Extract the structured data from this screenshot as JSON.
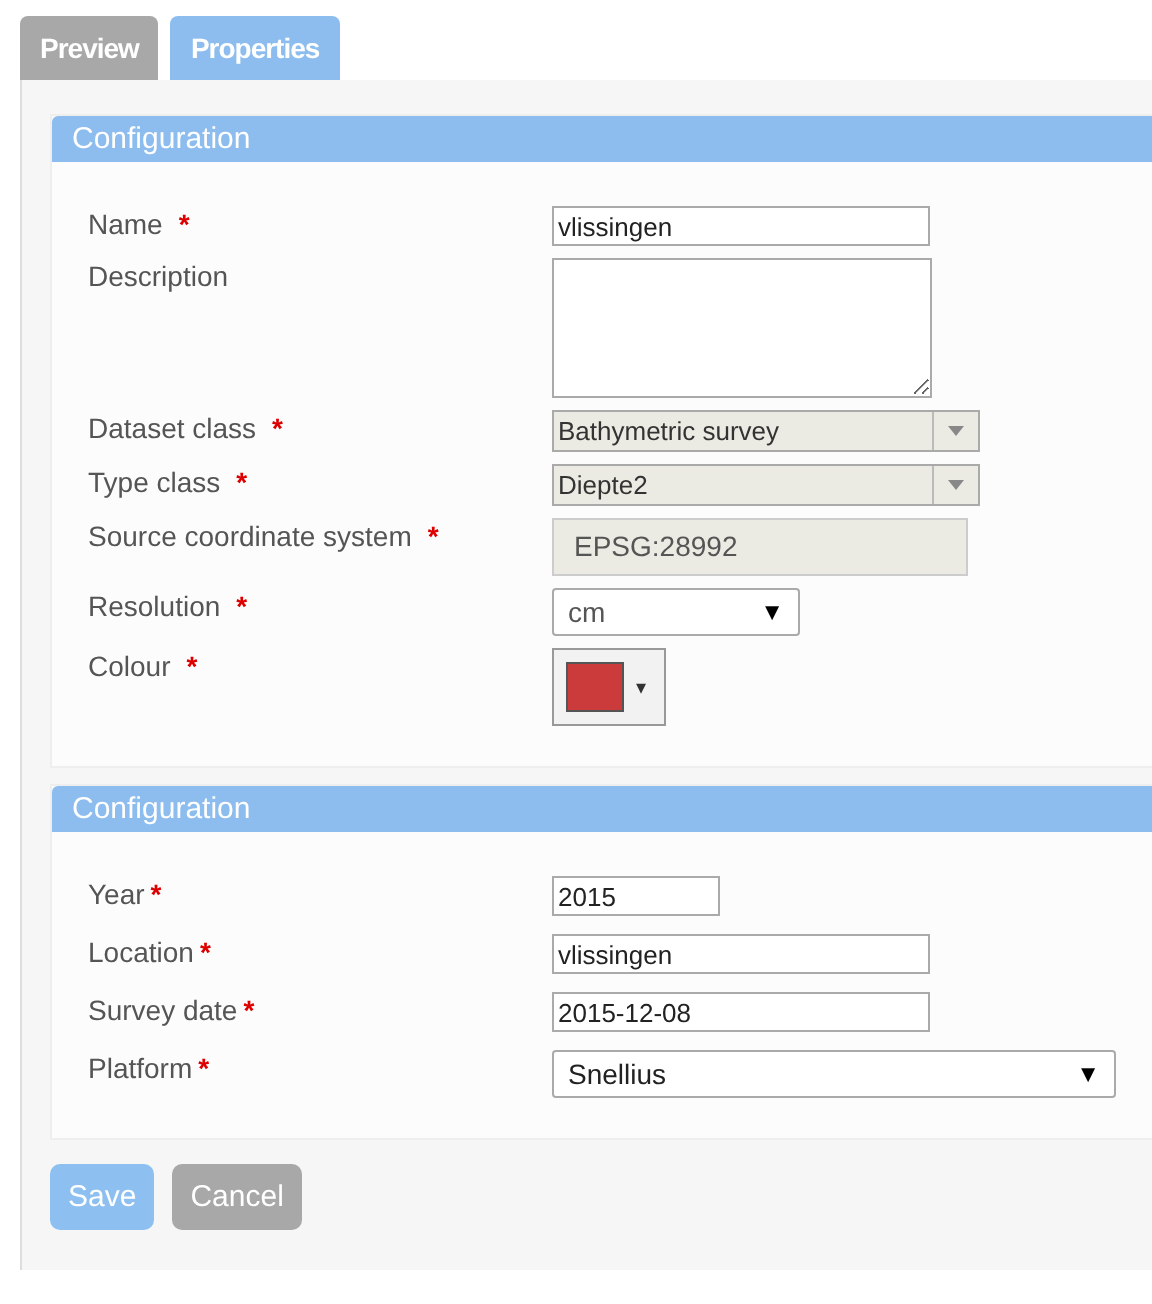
{
  "tabs": [
    {
      "label": "Preview",
      "selected": false
    },
    {
      "label": "Properties",
      "selected": true
    }
  ],
  "sections": [
    {
      "title": "Configuration",
      "fields": [
        {
          "label": "Name",
          "mark": "*",
          "kind": "text",
          "value": "vlissingen"
        },
        {
          "label": "Description",
          "kind": "textarea"
        },
        {
          "label": "Dataset class",
          "mark": "*",
          "kind": "locked-select",
          "value": "Bathymetric survey"
        },
        {
          "label": "Type class",
          "mark": "*",
          "kind": "locked-select",
          "value": "Diepte2"
        },
        {
          "label": "Source coordinate system",
          "mark": "*",
          "kind": "readonly",
          "value": "EPSG:28992"
        },
        {
          "label": "Resolution",
          "mark": "*",
          "kind": "select",
          "value": "cm",
          "arrow": "▼"
        },
        {
          "label": "Colour",
          "mark": "*",
          "kind": "color",
          "color": "#cc3b3b",
          "arrow": "▾"
        }
      ]
    },
    {
      "title": "Configuration",
      "fields": [
        {
          "label": "Year",
          "mark": "*",
          "kind": "short-text",
          "value": "2015"
        },
        {
          "label": "Location",
          "mark": "*",
          "kind": "text",
          "value": "vlissingen"
        },
        {
          "label": "Survey date",
          "mark": "*",
          "kind": "text",
          "value": "2015-12-08"
        },
        {
          "label": "Platform",
          "mark": "*",
          "kind": "wide-select",
          "value": "Snellius",
          "arrow": "▼"
        }
      ]
    }
  ],
  "buttons": [
    {
      "label": "Save",
      "kind": "primary"
    },
    {
      "label": "Cancel",
      "kind": "secondary"
    }
  ]
}
